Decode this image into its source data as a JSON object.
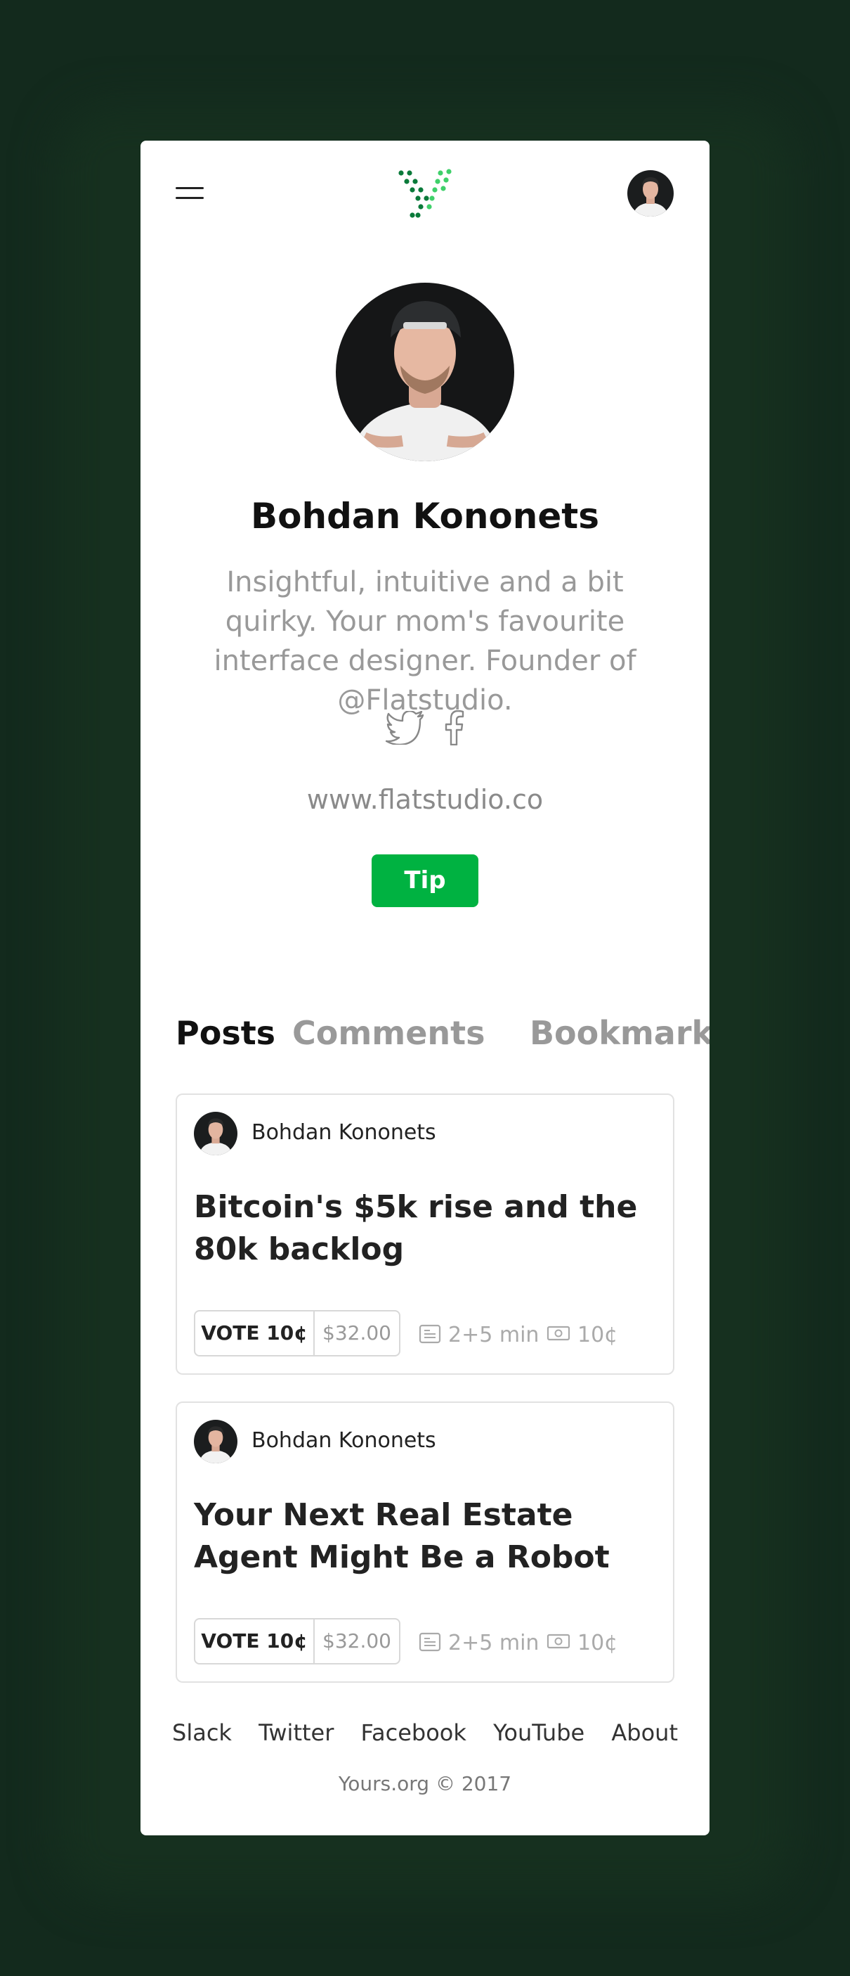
{
  "header": {
    "menu_icon": "hamburger-menu-icon",
    "logo_icon": "yours-dotted-y-logo",
    "avatar_icon": "user-avatar"
  },
  "profile": {
    "name": "Bohdan Kononets",
    "bio": "Insightful, intuitive and a bit quirky. Your mom's favourite interface designer. Founder of @Flatstudio.",
    "socials": [
      "twitter-icon",
      "facebook-icon"
    ],
    "website": "www.flatstudio.co",
    "tip_label": "Tip"
  },
  "tabs": [
    {
      "label": "Posts",
      "active": true
    },
    {
      "label": "Comments",
      "active": false
    },
    {
      "label": "Bookmarks",
      "active": false
    }
  ],
  "posts": [
    {
      "author": "Bohdan Kononets",
      "title": "Bitcoin's $5k rise and the 80k backlog",
      "vote_label": "VOTE 10¢",
      "vote_amount": "$32.00",
      "read_time": "2+5 min",
      "price": "10¢"
    },
    {
      "author": "Bohdan Kononets",
      "title": "Your Next Real Estate Agent Might Be a Robot",
      "vote_label": "VOTE 10¢",
      "vote_amount": "$32.00",
      "read_time": "2+5 min",
      "price": "10¢"
    }
  ],
  "footer": {
    "links": [
      "Slack",
      "Twitter",
      "Facebook",
      "YouTube",
      "About"
    ],
    "copyright": "Yours.org © 2017"
  },
  "colors": {
    "background": "#132a1d",
    "accent": "#00b241",
    "logo_dark": "#0a7a3a",
    "logo_light": "#3fd06a"
  }
}
